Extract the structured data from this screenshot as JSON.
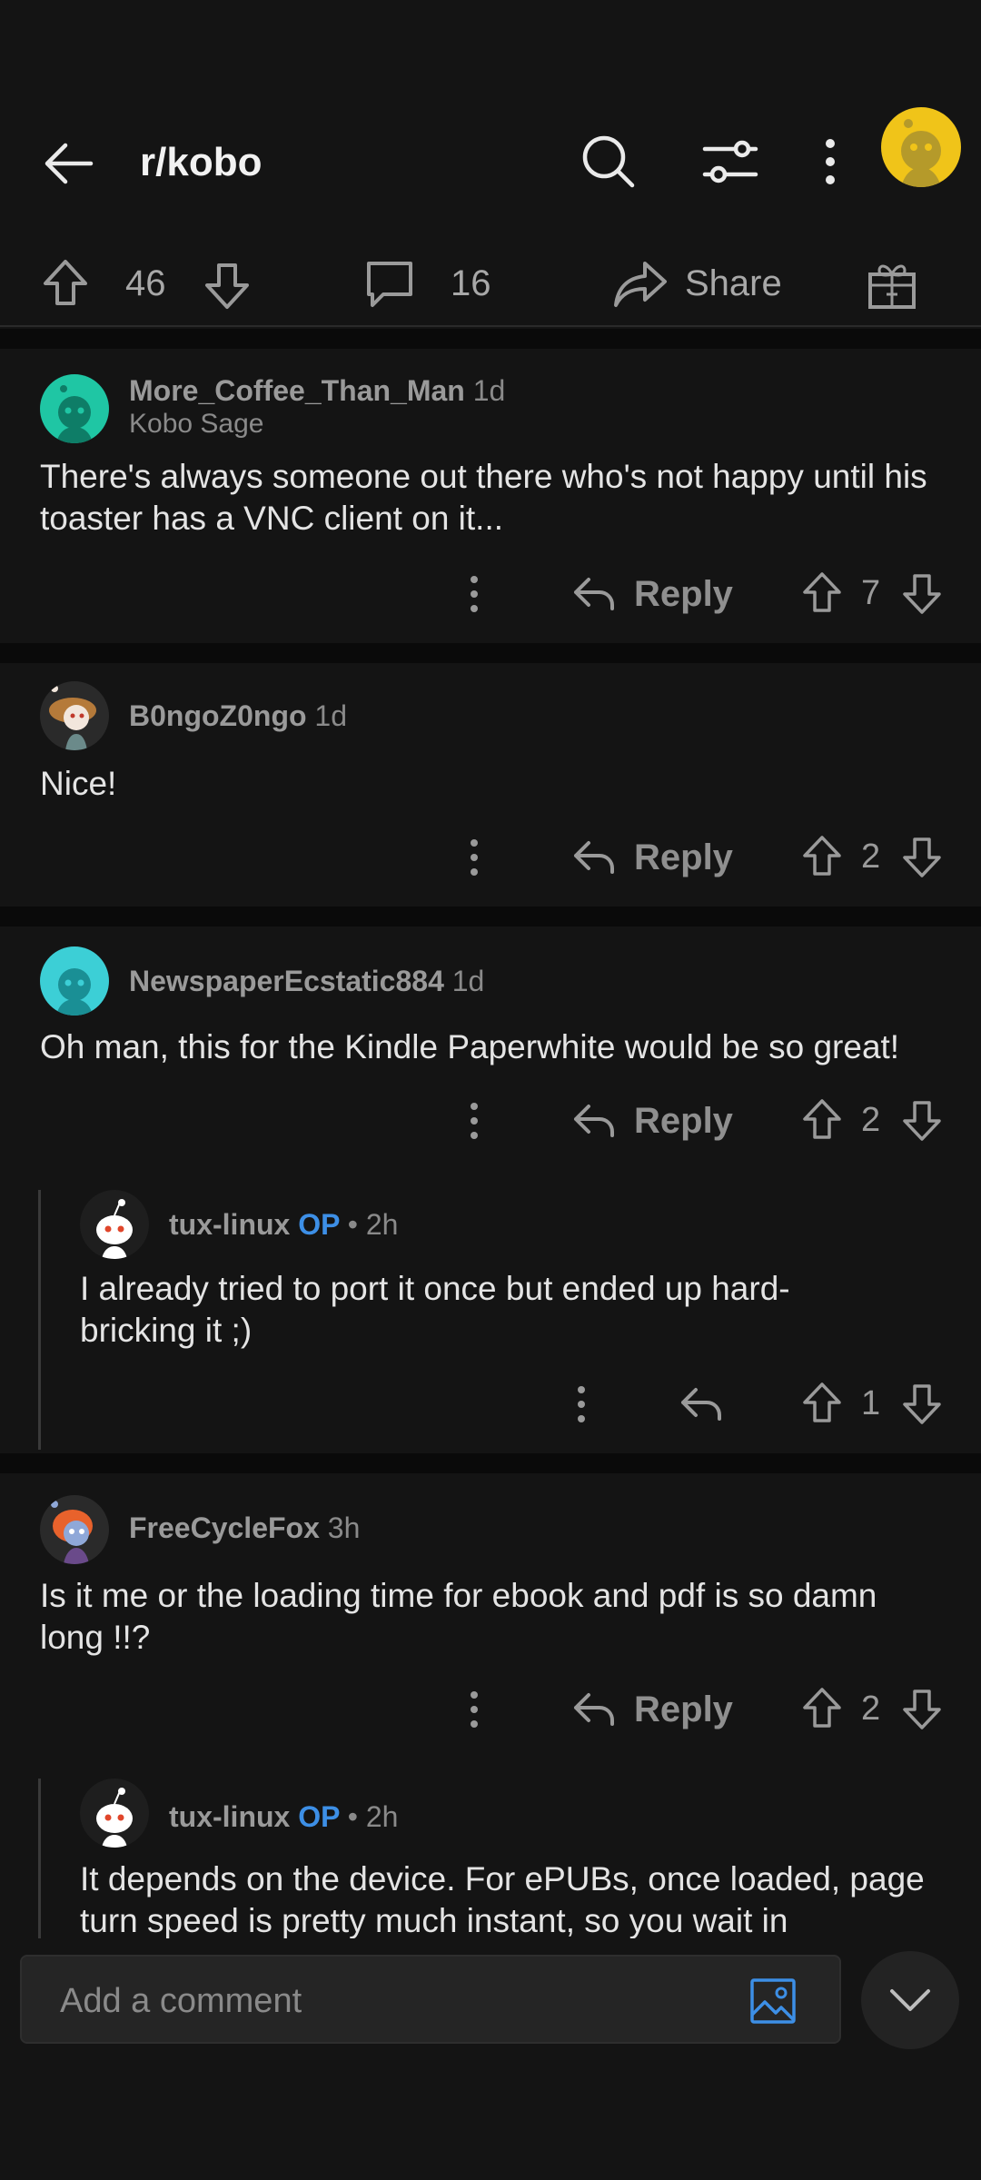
{
  "header": {
    "title": "r/kobo",
    "back_icon": "arrow-left-icon",
    "search_icon": "search-icon",
    "filter_icon": "sliders-icon",
    "more_icon": "more-vertical-icon",
    "avatar_color": "#f0c419"
  },
  "post_actions": {
    "upvotes": "46",
    "comments": "16",
    "share_label": "Share"
  },
  "comments": [
    {
      "username": "More_Coffee_Than_Man",
      "time": "1d",
      "flair": "Kobo Sage",
      "text": "There's always someone out there who's not happy until his toaster has a VNC client on it...",
      "reply_label": "Reply",
      "votes": "7"
    },
    {
      "username": "B0ngoZ0ngo",
      "time": "1d",
      "text": "Nice!",
      "reply_label": "Reply",
      "votes": "2"
    },
    {
      "username": "NewspaperEcstatic884",
      "time": "1d",
      "text": "Oh man, this for the Kindle Paperwhite would be so great!",
      "reply_label": "Reply",
      "votes": "2"
    },
    {
      "username": "tux-linux",
      "op": "OP",
      "time": "2h",
      "text": "I already tried to port it once but ended up hard-bricking it ;)",
      "votes": "1"
    },
    {
      "username": "FreeCycleFox",
      "time": "3h",
      "text": "Is it me or the loading time for ebook and pdf is so damn long !!?",
      "reply_label": "Reply",
      "votes": "2"
    },
    {
      "username": "tux-linux",
      "op": "OP",
      "time": "2h",
      "text": "It depends on the device. For ePUBs, once loaded, page turn speed is pretty much instant, so you wait in"
    }
  ],
  "composer": {
    "placeholder": "Add a comment",
    "image_icon": "image-icon",
    "accent": "#3d8fe6"
  },
  "scroll_button_icon": "chevron-down-icon"
}
